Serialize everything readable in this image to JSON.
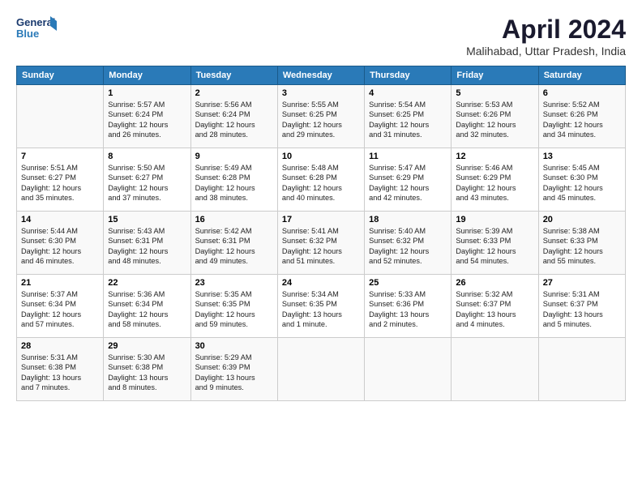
{
  "header": {
    "logo_line1": "General",
    "logo_line2": "Blue",
    "title": "April 2024",
    "location": "Malihabad, Uttar Pradesh, India"
  },
  "weekdays": [
    "Sunday",
    "Monday",
    "Tuesday",
    "Wednesday",
    "Thursday",
    "Friday",
    "Saturday"
  ],
  "weeks": [
    [
      {
        "day": "",
        "text": ""
      },
      {
        "day": "1",
        "text": "Sunrise: 5:57 AM\nSunset: 6:24 PM\nDaylight: 12 hours\nand 26 minutes."
      },
      {
        "day": "2",
        "text": "Sunrise: 5:56 AM\nSunset: 6:24 PM\nDaylight: 12 hours\nand 28 minutes."
      },
      {
        "day": "3",
        "text": "Sunrise: 5:55 AM\nSunset: 6:25 PM\nDaylight: 12 hours\nand 29 minutes."
      },
      {
        "day": "4",
        "text": "Sunrise: 5:54 AM\nSunset: 6:25 PM\nDaylight: 12 hours\nand 31 minutes."
      },
      {
        "day": "5",
        "text": "Sunrise: 5:53 AM\nSunset: 6:26 PM\nDaylight: 12 hours\nand 32 minutes."
      },
      {
        "day": "6",
        "text": "Sunrise: 5:52 AM\nSunset: 6:26 PM\nDaylight: 12 hours\nand 34 minutes."
      }
    ],
    [
      {
        "day": "7",
        "text": "Sunrise: 5:51 AM\nSunset: 6:27 PM\nDaylight: 12 hours\nand 35 minutes."
      },
      {
        "day": "8",
        "text": "Sunrise: 5:50 AM\nSunset: 6:27 PM\nDaylight: 12 hours\nand 37 minutes."
      },
      {
        "day": "9",
        "text": "Sunrise: 5:49 AM\nSunset: 6:28 PM\nDaylight: 12 hours\nand 38 minutes."
      },
      {
        "day": "10",
        "text": "Sunrise: 5:48 AM\nSunset: 6:28 PM\nDaylight: 12 hours\nand 40 minutes."
      },
      {
        "day": "11",
        "text": "Sunrise: 5:47 AM\nSunset: 6:29 PM\nDaylight: 12 hours\nand 42 minutes."
      },
      {
        "day": "12",
        "text": "Sunrise: 5:46 AM\nSunset: 6:29 PM\nDaylight: 12 hours\nand 43 minutes."
      },
      {
        "day": "13",
        "text": "Sunrise: 5:45 AM\nSunset: 6:30 PM\nDaylight: 12 hours\nand 45 minutes."
      }
    ],
    [
      {
        "day": "14",
        "text": "Sunrise: 5:44 AM\nSunset: 6:30 PM\nDaylight: 12 hours\nand 46 minutes."
      },
      {
        "day": "15",
        "text": "Sunrise: 5:43 AM\nSunset: 6:31 PM\nDaylight: 12 hours\nand 48 minutes."
      },
      {
        "day": "16",
        "text": "Sunrise: 5:42 AM\nSunset: 6:31 PM\nDaylight: 12 hours\nand 49 minutes."
      },
      {
        "day": "17",
        "text": "Sunrise: 5:41 AM\nSunset: 6:32 PM\nDaylight: 12 hours\nand 51 minutes."
      },
      {
        "day": "18",
        "text": "Sunrise: 5:40 AM\nSunset: 6:32 PM\nDaylight: 12 hours\nand 52 minutes."
      },
      {
        "day": "19",
        "text": "Sunrise: 5:39 AM\nSunset: 6:33 PM\nDaylight: 12 hours\nand 54 minutes."
      },
      {
        "day": "20",
        "text": "Sunrise: 5:38 AM\nSunset: 6:33 PM\nDaylight: 12 hours\nand 55 minutes."
      }
    ],
    [
      {
        "day": "21",
        "text": "Sunrise: 5:37 AM\nSunset: 6:34 PM\nDaylight: 12 hours\nand 57 minutes."
      },
      {
        "day": "22",
        "text": "Sunrise: 5:36 AM\nSunset: 6:34 PM\nDaylight: 12 hours\nand 58 minutes."
      },
      {
        "day": "23",
        "text": "Sunrise: 5:35 AM\nSunset: 6:35 PM\nDaylight: 12 hours\nand 59 minutes."
      },
      {
        "day": "24",
        "text": "Sunrise: 5:34 AM\nSunset: 6:35 PM\nDaylight: 13 hours\nand 1 minute."
      },
      {
        "day": "25",
        "text": "Sunrise: 5:33 AM\nSunset: 6:36 PM\nDaylight: 13 hours\nand 2 minutes."
      },
      {
        "day": "26",
        "text": "Sunrise: 5:32 AM\nSunset: 6:37 PM\nDaylight: 13 hours\nand 4 minutes."
      },
      {
        "day": "27",
        "text": "Sunrise: 5:31 AM\nSunset: 6:37 PM\nDaylight: 13 hours\nand 5 minutes."
      }
    ],
    [
      {
        "day": "28",
        "text": "Sunrise: 5:31 AM\nSunset: 6:38 PM\nDaylight: 13 hours\nand 7 minutes."
      },
      {
        "day": "29",
        "text": "Sunrise: 5:30 AM\nSunset: 6:38 PM\nDaylight: 13 hours\nand 8 minutes."
      },
      {
        "day": "30",
        "text": "Sunrise: 5:29 AM\nSunset: 6:39 PM\nDaylight: 13 hours\nand 9 minutes."
      },
      {
        "day": "",
        "text": ""
      },
      {
        "day": "",
        "text": ""
      },
      {
        "day": "",
        "text": ""
      },
      {
        "day": "",
        "text": ""
      }
    ]
  ]
}
